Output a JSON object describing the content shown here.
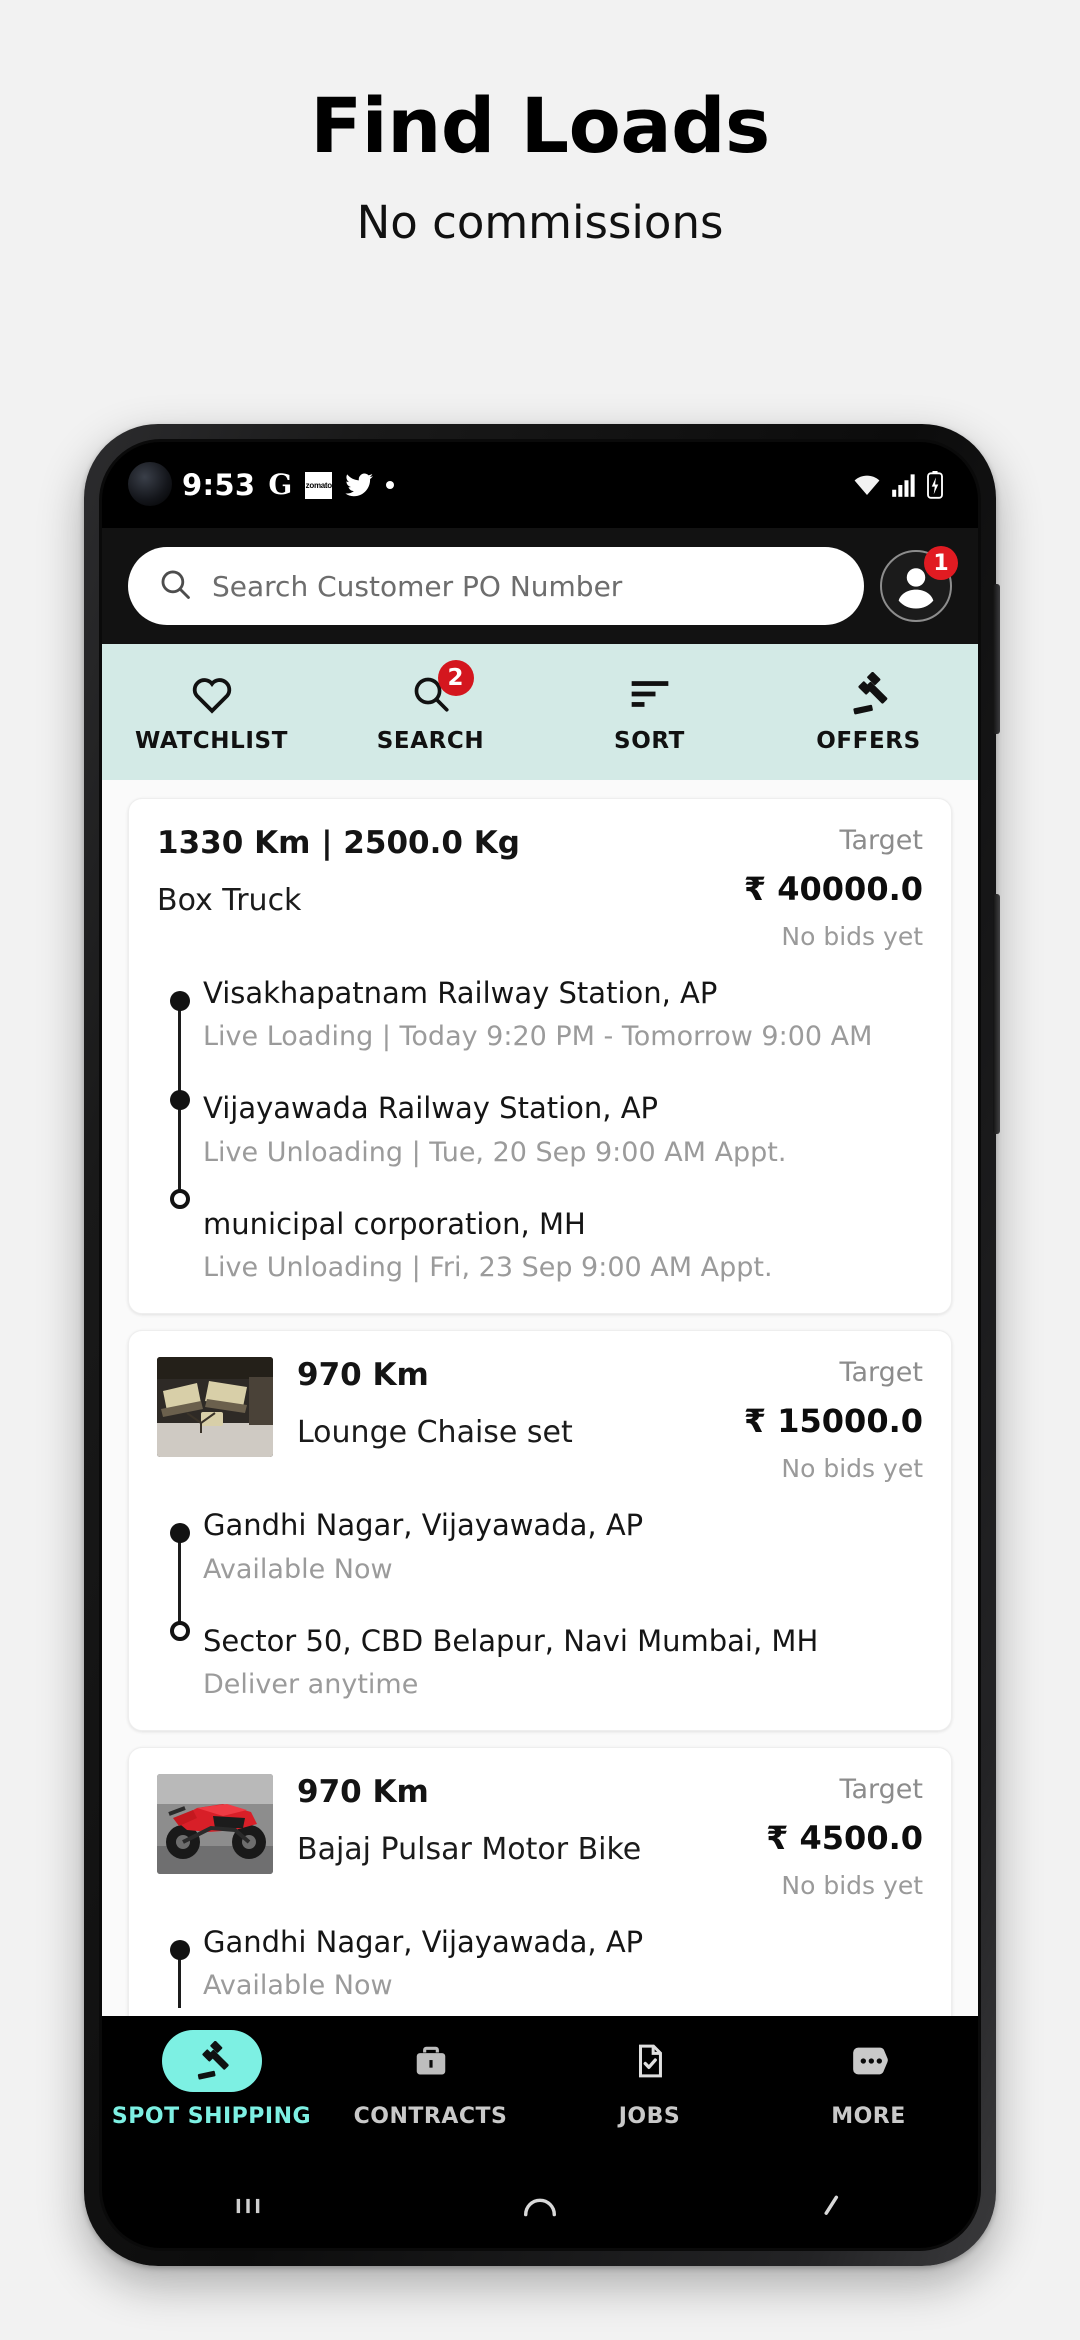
{
  "promo": {
    "title": "Find Loads",
    "subtitle": "No commissions"
  },
  "statusbar": {
    "time": "9:53",
    "icons": [
      "google-icon",
      "zomato-icon",
      "twitter-icon",
      "dot-icon"
    ],
    "zomato_text": "zomato",
    "right_icons": [
      "wifi-icon",
      "signal-icon",
      "battery-charging-icon"
    ]
  },
  "search": {
    "placeholder": "Search Customer PO Number",
    "value": "",
    "icon": "search-icon",
    "avatar_badge": "1"
  },
  "tabs": [
    {
      "label": "WATCHLIST",
      "icon": "heart-icon",
      "badge": ""
    },
    {
      "label": "SEARCH",
      "icon": "search-icon",
      "badge": "2"
    },
    {
      "label": "SORT",
      "icon": "sort-icon",
      "badge": ""
    },
    {
      "label": "OFFERS",
      "icon": "gavel-icon",
      "badge": ""
    }
  ],
  "target_label": "Target",
  "cards": [
    {
      "km": "1330 Km | 2500.0 Kg",
      "commodity": "Box Truck",
      "target_label": "Target",
      "target_amount": "₹ 40000.0",
      "bids": "No bids yet",
      "has_thumb": false,
      "stops": [
        {
          "name": "Visakhapatnam Railway Station, AP",
          "detail": "Live Loading | Today 9:20 PM - Tomorrow 9:00 AM",
          "type": "filled"
        },
        {
          "name": "Vijayawada Railway Station, AP",
          "detail": "Live Unloading | Tue, 20 Sep 9:00 AM Appt.",
          "type": "filled"
        },
        {
          "name": "municipal corporation, MH",
          "detail": "Live Unloading | Fri, 23 Sep 9:00 AM Appt.",
          "type": "hollow"
        }
      ]
    },
    {
      "km": "970 Km",
      "commodity": "Lounge Chaise set",
      "target_label": "Target",
      "target_amount": "₹ 15000.0",
      "bids": "No bids yet",
      "has_thumb": true,
      "thumb": "lounge-chaise-set-photo",
      "stops": [
        {
          "name": "Gandhi Nagar, Vijayawada, AP",
          "detail": "Available Now",
          "type": "filled"
        },
        {
          "name": "Sector 50, CBD Belapur, Navi Mumbai, MH",
          "detail": "Deliver anytime",
          "type": "hollow"
        }
      ]
    },
    {
      "km": "970 Km",
      "commodity": "Bajaj Pulsar Motor Bike",
      "target_label": "Target",
      "target_amount": "₹ 4500.0",
      "bids": "No bids yet",
      "has_thumb": true,
      "thumb": "bajaj-pulsar-motor-bike-photo",
      "stops": [
        {
          "name": "Gandhi Nagar, Vijayawada, AP",
          "detail": "Available Now",
          "type": "filled"
        }
      ]
    }
  ],
  "bottom_nav": [
    {
      "label": "SPOT SHIPPING",
      "icon": "gavel-icon",
      "active": true
    },
    {
      "label": "CONTRACTS",
      "icon": "briefcase-icon",
      "active": false
    },
    {
      "label": "JOBS",
      "icon": "document-check-icon",
      "active": false
    },
    {
      "label": "MORE",
      "icon": "more-dots-icon",
      "active": false
    }
  ],
  "system_nav": [
    "recents-icon",
    "home-icon",
    "back-icon"
  ],
  "colors": {
    "accent_mint": "#d3eae6",
    "accent_cyan": "#7df0e3",
    "badge_red": "#d4161e",
    "page_bg": "#f2f2f2"
  }
}
